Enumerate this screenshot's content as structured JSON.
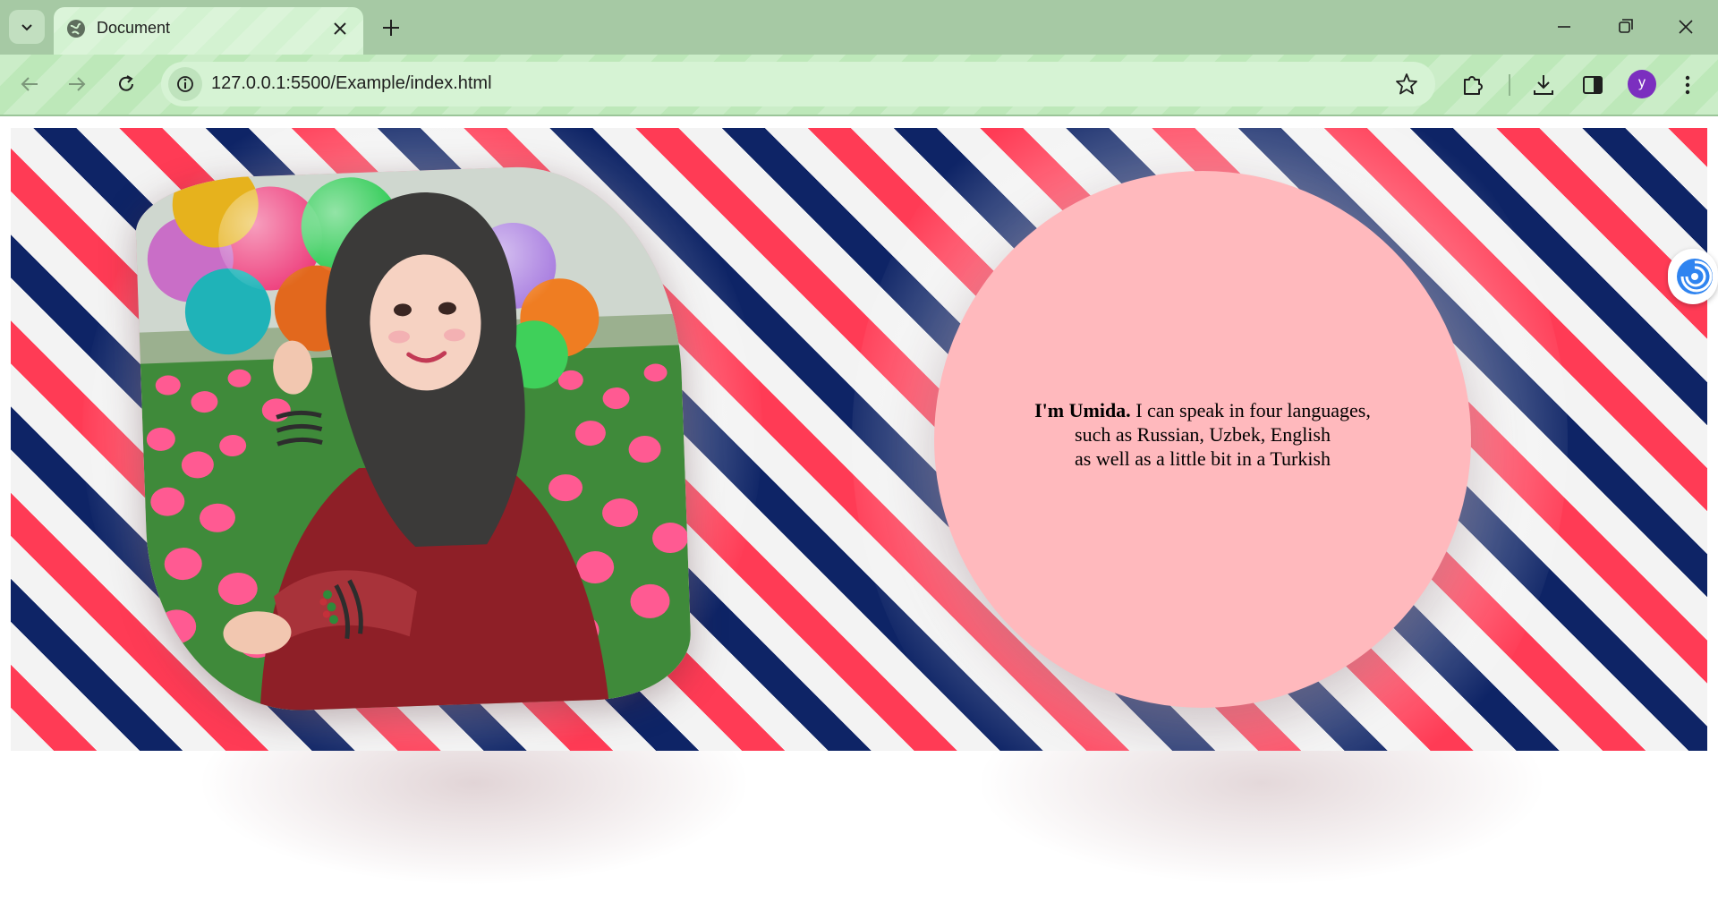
{
  "browser": {
    "tab": {
      "title": "Document",
      "favicon": "globe-icon"
    },
    "address_bar": {
      "url": "127.0.0.1:5500/Example/index.html"
    },
    "profile": {
      "initial": "y",
      "color": "#7b2fbf"
    },
    "theme": {
      "frame": "#a6c9a4",
      "toolbar": "#bde8b9",
      "omnibox": "#d6f3d4"
    }
  },
  "page": {
    "banner_stripes": [
      "#f3f3f3",
      "#ff3b55",
      "#f3f3f3",
      "#0e2466"
    ],
    "circle_color": "#ffb9bd",
    "intro": {
      "name": "I'm Umida.",
      "line1": " I can speak in four languages,",
      "line2": "such as Russian, Uzbek, English",
      "line3": "as well as a little bit in a Turkish"
    },
    "photo": {
      "alt_subject": "girl in hijab with balloons in tulip field"
    }
  }
}
